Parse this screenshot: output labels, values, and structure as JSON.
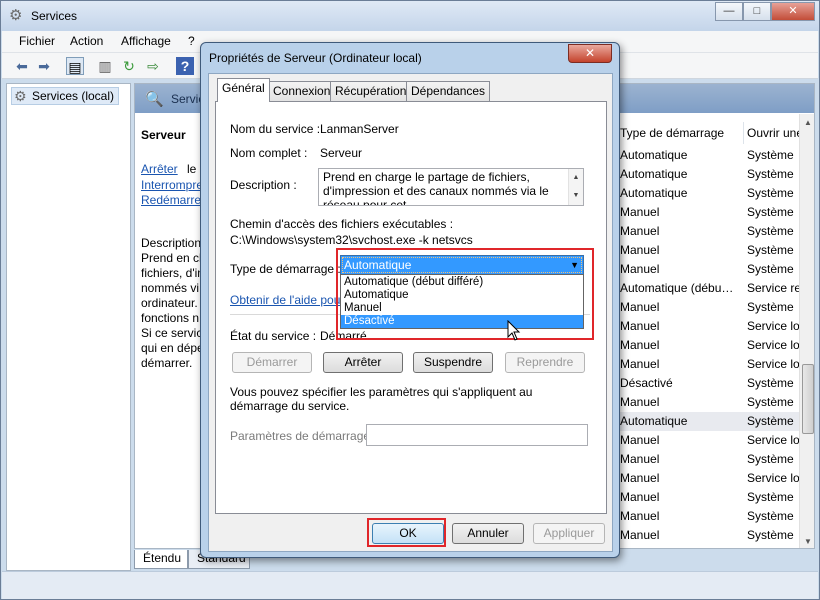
{
  "window": {
    "title": "Services",
    "controls": [
      "—",
      "□",
      "✕"
    ]
  },
  "menu": [
    "Fichier",
    "Action",
    "Affichage",
    "?"
  ],
  "tree": {
    "root": "Services (local)"
  },
  "right_header": "Services",
  "service_panel": {
    "name": "Serveur",
    "links": [
      {
        "text": "Arrêter",
        "suffix": "le service"
      },
      {
        "text": "Interrompre",
        "suffix": ""
      },
      {
        "text": "Redémarrer",
        "suffix": ""
      }
    ],
    "description_lines": [
      "Description :",
      "Prend en ch",
      "fichiers, d'im",
      "nommés vi",
      "ordinateur.",
      "fonctions n",
      "Si ce service",
      "qui en dépe",
      "démarrer."
    ]
  },
  "list": {
    "columns": [
      "Type de démarrage",
      "Ouvrir une"
    ],
    "rows": [
      [
        "Automatique",
        "Système"
      ],
      [
        "Automatique",
        "Système"
      ],
      [
        "Automatique",
        "Système"
      ],
      [
        "Manuel",
        "Système"
      ],
      [
        "Manuel",
        "Système"
      ],
      [
        "Manuel",
        "Système"
      ],
      [
        "Manuel",
        "Système"
      ],
      [
        "Automatique (débu…",
        "Service re"
      ],
      [
        "Manuel",
        "Système"
      ],
      [
        "Manuel",
        "Service lo"
      ],
      [
        "Manuel",
        "Service lo"
      ],
      [
        "Manuel",
        "Service lo"
      ],
      [
        "Désactivé",
        "Système"
      ],
      [
        "Manuel",
        "Système"
      ],
      [
        "Automatique",
        "Système"
      ],
      [
        "Manuel",
        "Service lo"
      ],
      [
        "Manuel",
        "Système"
      ],
      [
        "Manuel",
        "Service lo"
      ],
      [
        "Manuel",
        "Système"
      ],
      [
        "Manuel",
        "Système"
      ],
      [
        "Manuel",
        "Système"
      ]
    ],
    "selected_index": 14
  },
  "bottom_tabs": [
    "Étendu",
    "Standard"
  ],
  "dialog": {
    "title": "Propriétés de Serveur (Ordinateur local)",
    "close_label": "✕",
    "tabs": [
      "Général",
      "Connexion",
      "Récupération",
      "Dépendances"
    ],
    "active_tab": 0,
    "service_name_label": "Nom du service :",
    "service_name_value": "LanmanServer",
    "display_name_label": "Nom complet :",
    "display_name_value": "Serveur",
    "description_label": "Description :",
    "description_value": "Prend en charge le partage de fichiers, d'impression et des canaux nommés via le réseau pour cet",
    "path_label": "Chemin d'accès des fichiers exécutables :",
    "path_value": "C:\\Windows\\system32\\svchost.exe -k netsvcs",
    "startup_type_label": "Type de démarrage :",
    "startup_type_value": "Automatique",
    "startup_options": [
      "Automatique (début différé)",
      "Automatique",
      "Manuel",
      "Désactivé"
    ],
    "highlighted_option": 3,
    "help_link": "Obtenir de l'aide pour co",
    "status_label": "État du service :",
    "status_value": "Démarré",
    "buttons": {
      "start": "Démarrer",
      "stop": "Arrêter",
      "pause": "Suspendre",
      "resume": "Reprendre"
    },
    "params_hint": "Vous pouvez spécifier les paramètres qui s'appliquent au démarrage du service.",
    "params_label": "Paramètres de démarrage :",
    "params_value": "",
    "footer": {
      "ok": "OK",
      "cancel": "Annuler",
      "apply": "Appliquer"
    }
  },
  "highlight_color": "#e0262a",
  "accent_color": "#3399ff"
}
